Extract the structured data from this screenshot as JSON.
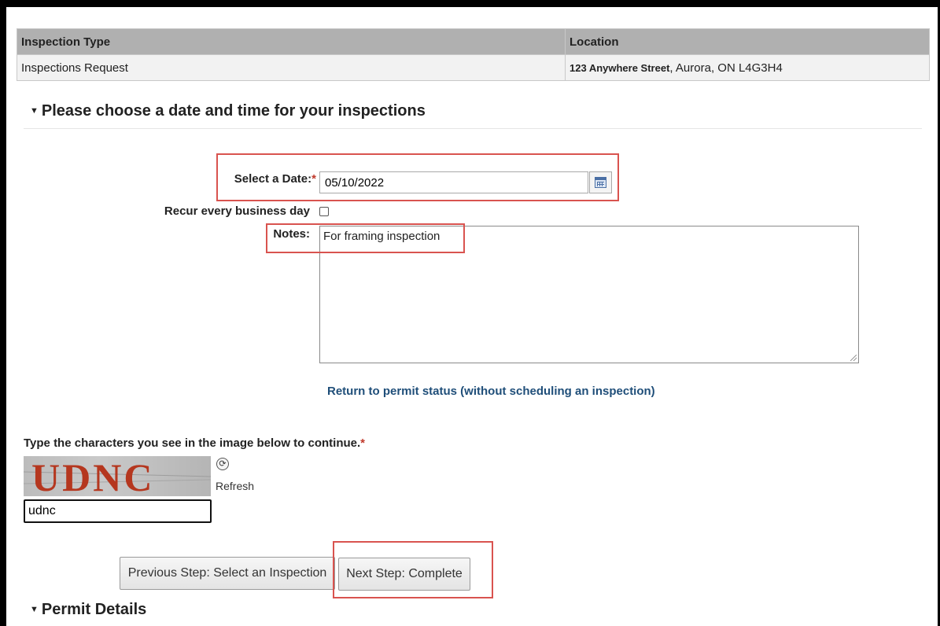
{
  "table": {
    "headers": [
      "Inspection Type",
      "Location"
    ],
    "rows": [
      {
        "type": "Inspections Request",
        "street": "123 Anywhere Street",
        "city": ", Aurora, ON L4G3H4"
      }
    ]
  },
  "section": {
    "title": "Please choose a date and time for your inspections"
  },
  "form": {
    "date_label": "Select a Date:",
    "required_mark": "*",
    "date_value": "05/10/2022",
    "recur_label": "Recur every business day",
    "notes_label": "Notes:",
    "notes_value": "For framing inspection",
    "return_link": "Return to permit status (without scheduling an inspection)"
  },
  "captcha": {
    "label": "Type the characters you see in the image below to continue.",
    "image_text": "UDNC",
    "refresh_label": "Refresh",
    "input_value": "udnc"
  },
  "buttons": {
    "previous": "Previous Step: Select an Inspection",
    "next": "Next Step: Complete"
  },
  "section2": {
    "title": "Permit Details"
  },
  "colors": {
    "highlight": "#d9534f",
    "link": "#1f4e79",
    "required": "#c0392b",
    "header_bg": "#b0b0b0",
    "captcha_text": "#b5371f"
  },
  "icons": [
    "calendar-icon",
    "refresh-icon",
    "caret-down-icon",
    "resize-grip-icon"
  ]
}
